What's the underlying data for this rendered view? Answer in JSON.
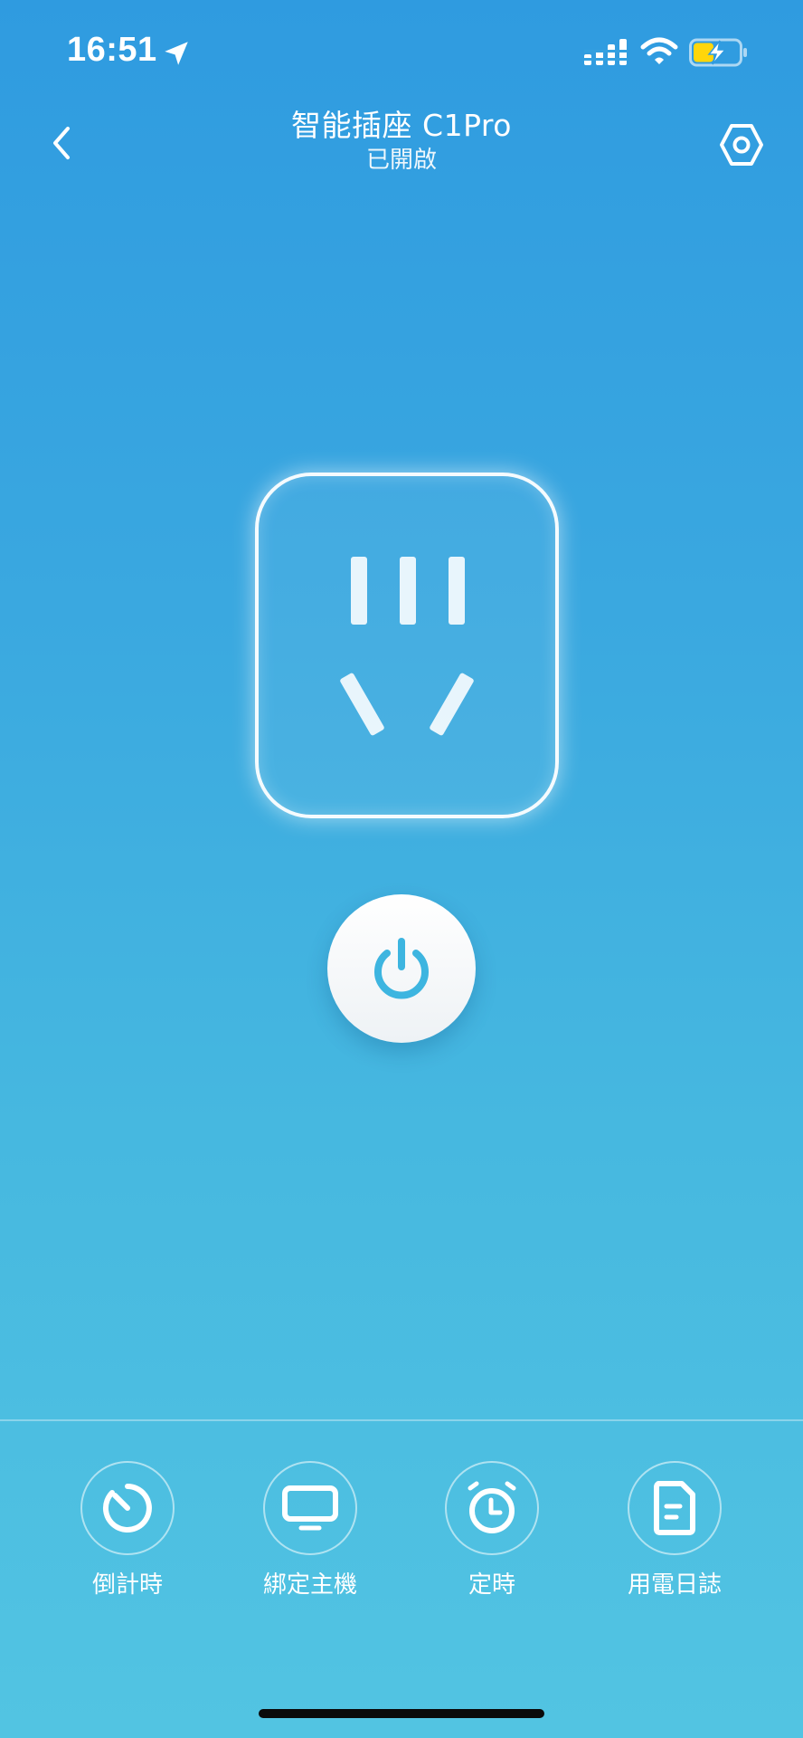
{
  "status_bar": {
    "time": "16:51"
  },
  "header": {
    "title": "智能插座 C1Pro",
    "subtitle": "已開啟"
  },
  "colors": {
    "accent": "#3db5e0",
    "background_top": "#2f9be0",
    "background_bottom": "#52c4e2",
    "battery_fill": "#ffd60a"
  },
  "toolbar": {
    "items": [
      {
        "label": "倒計時",
        "icon": "countdown-timer-icon"
      },
      {
        "label": "綁定主機",
        "icon": "monitor-icon"
      },
      {
        "label": "定時",
        "icon": "alarm-clock-icon"
      },
      {
        "label": "用電日誌",
        "icon": "document-icon"
      }
    ]
  }
}
